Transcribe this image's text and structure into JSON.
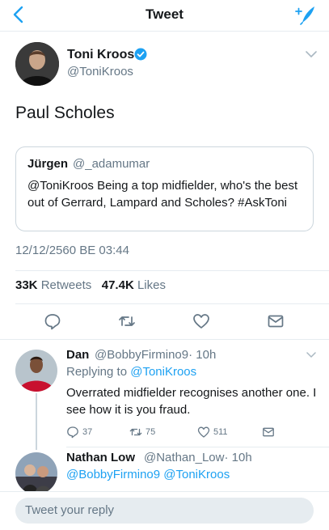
{
  "nav": {
    "title": "Tweet",
    "back_icon": "chevron-left-icon",
    "compose_icon": "compose-tweet-icon"
  },
  "tweet": {
    "author_name": "Toni Kroos",
    "author_handle": "@ToniKroos",
    "verified": true,
    "text": "Paul Scholes",
    "quote": {
      "author_name": "Jürgen",
      "author_handle": "@_adamumar",
      "text": "@ToniKroos Being a top midfielder, who's the best out of Gerrard, Lampard and Scholes? #AskToni"
    },
    "timestamp": "12/12/2560 BE 03:44",
    "retweets_count": "33K",
    "retweets_label": "Retweets",
    "likes_count": "47.4K",
    "likes_label": "Likes"
  },
  "replies": [
    {
      "author_name": "Dan",
      "author_handle": "@BobbyFirmino9",
      "time": "· 10h",
      "replying_prefix": "Replying to",
      "replying_to": "@ToniKroos",
      "text": "Overrated midfielder recognises another one. I see how it is you fraud.",
      "reply_count": "37",
      "retweet_count": "75",
      "like_count": "511"
    },
    {
      "author_name": "Nathan Low",
      "author_handle": "@Nathan_Low",
      "time": "· 10h",
      "mentions": "@BobbyFirmino9 @ToniKroos"
    }
  ],
  "reply_composer": {
    "placeholder": "Tweet your reply"
  },
  "colors": {
    "accent": "#1da1f2",
    "secondary_text": "#657786",
    "border": "#e6ecf0"
  }
}
